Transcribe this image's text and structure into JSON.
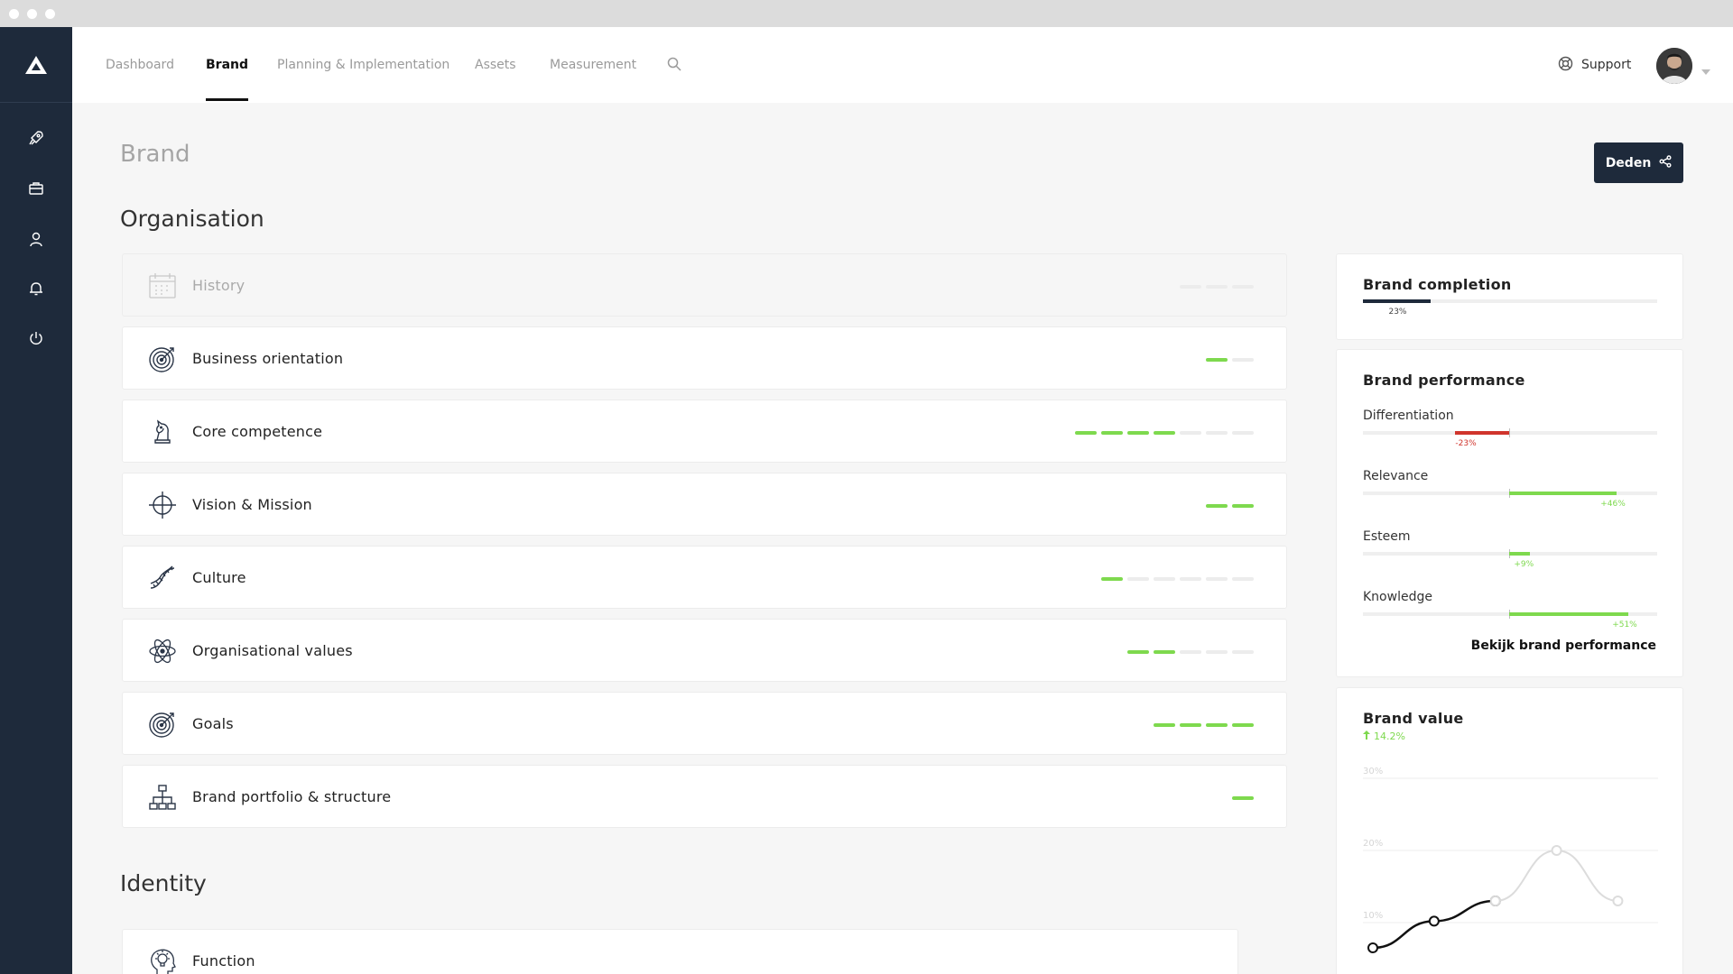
{
  "nav": {
    "tabs": [
      {
        "label": "Dashboard",
        "active": false
      },
      {
        "label": "Brand",
        "active": true
      },
      {
        "label": "Planning & Implementation",
        "active": false
      },
      {
        "label": "Assets",
        "active": false
      },
      {
        "label": "Measurement",
        "active": false
      }
    ],
    "search_icon": "search-icon",
    "support_label": "Support",
    "support_icon": "lifebuoy-icon"
  },
  "sidebar": {
    "logo": "brand-logo-icon",
    "items": [
      "rocket-icon",
      "briefcase-icon",
      "user-icon",
      "bell-icon",
      "power-icon"
    ]
  },
  "page": {
    "title": "Brand",
    "share_label": "Deden",
    "share_icon": "share-icon"
  },
  "sections": {
    "organisation_title": "Organisation",
    "identity_title": "Identity"
  },
  "organisation_items": [
    {
      "label": "History",
      "icon": "calendar-icon",
      "progress": [
        0,
        0,
        0
      ],
      "disabled": true
    },
    {
      "label": "Business orientation",
      "icon": "target-icon",
      "progress": [
        1,
        0
      ],
      "disabled": false
    },
    {
      "label": "Core competence",
      "icon": "chess-knight-icon",
      "progress": [
        1,
        1,
        1,
        1,
        0,
        0,
        0
      ],
      "disabled": false
    },
    {
      "label": "Vision & Mission",
      "icon": "crosshair-icon",
      "progress": [
        1,
        1
      ],
      "disabled": false
    },
    {
      "label": "Culture",
      "icon": "dna-icon",
      "progress": [
        1,
        0,
        0,
        0,
        0,
        0
      ],
      "disabled": false
    },
    {
      "label": "Organisational values",
      "icon": "atom-icon",
      "progress": [
        1,
        1,
        0,
        0,
        0
      ],
      "disabled": false
    },
    {
      "label": "Goals",
      "icon": "target-icon",
      "progress": [
        1,
        1,
        1,
        1
      ],
      "disabled": false
    },
    {
      "label": "Brand portfolio & structure",
      "icon": "org-chart-icon",
      "progress": [
        1
      ],
      "disabled": false
    }
  ],
  "identity_items": [
    {
      "label": "Function",
      "icon": "head-lightbulb-icon"
    }
  ],
  "brand_completion": {
    "title": "Brand completion",
    "value": 0.23,
    "value_label": "23%",
    "color": "#1e2a3b"
  },
  "brand_performance": {
    "title": "Brand performance",
    "metrics": [
      {
        "label": "Differentiation",
        "value": -23,
        "value_label": "-23%",
        "color": "#d0342c"
      },
      {
        "label": "Relevance",
        "value": 46,
        "value_label": "+46%",
        "color": "#7ed94e"
      },
      {
        "label": "Esteem",
        "value": 9,
        "value_label": "+9%",
        "color": "#7ed94e"
      },
      {
        "label": "Knowledge",
        "value": 51,
        "value_label": "+51%",
        "color": "#7ed94e"
      }
    ],
    "link_label": "Bekijk brand performance"
  },
  "brand_value": {
    "title": "Brand value",
    "change_label": "14.2%",
    "change_icon": "arrow-up-icon",
    "accent": "#7ed94e"
  },
  "chart_data": {
    "type": "line",
    "title": "Brand value",
    "ytick_labels": [
      "30%",
      "20%",
      "10%"
    ],
    "ylim": [
      5,
      30
    ],
    "series": [
      {
        "values_x": [
          0,
          1,
          2
        ],
        "values": [
          6.5,
          10.2,
          13
        ]
      },
      {
        "values_x": [
          2,
          3,
          4
        ],
        "values": [
          13,
          20,
          13
        ]
      }
    ]
  }
}
